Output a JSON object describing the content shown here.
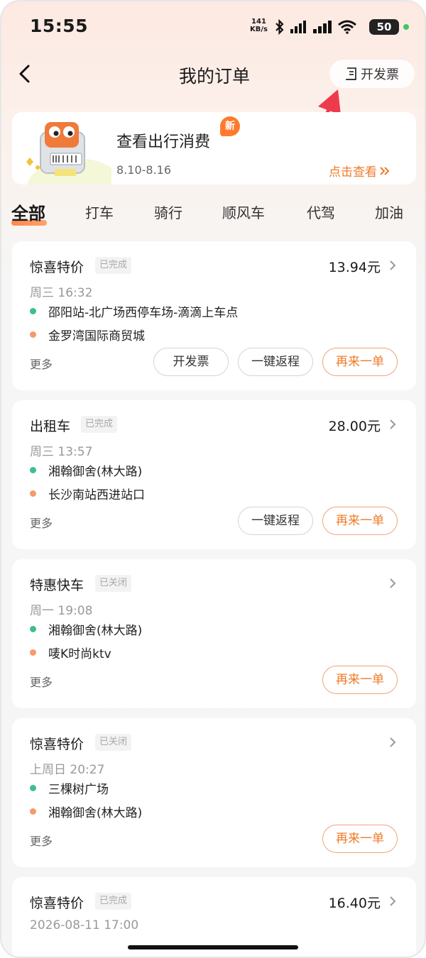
{
  "status_bar": {
    "time": "15:55",
    "network_speed": "141",
    "network_unit": "KB/s",
    "battery": "50"
  },
  "header": {
    "title": "我的订单",
    "invoice_label": "开发票"
  },
  "banner": {
    "title": "查看出行消费",
    "badge": "新",
    "date_range": "8.10-8.16",
    "link_label": "点击查看"
  },
  "tabs": [
    {
      "label": "全部",
      "active": true
    },
    {
      "label": "打车",
      "active": false
    },
    {
      "label": "骑行",
      "active": false
    },
    {
      "label": "顺风车",
      "active": false
    },
    {
      "label": "代驾",
      "active": false
    },
    {
      "label": "加油",
      "active": false
    }
  ],
  "orders": [
    {
      "title": "惊喜特价",
      "status": "已完成",
      "price": "13.94元",
      "time": "周三 16:32",
      "from": "邵阳站-北广场西停车场-滴滴上车点",
      "to": "金罗湾国际商贸城",
      "more": "更多",
      "buttons": [
        "开发票",
        "一键返程",
        "再来一单"
      ]
    },
    {
      "title": "出租车",
      "status": "已完成",
      "price": "28.00元",
      "time": "周三 13:57",
      "from": "湘翰御舍(林大路)",
      "to": "长沙南站西进站口",
      "more": "更多",
      "buttons": [
        "一键返程",
        "再来一单"
      ]
    },
    {
      "title": "特惠快车",
      "status": "已关闭",
      "price": "",
      "time": "周一 19:08",
      "from": "湘翰御舍(林大路)",
      "to": "唛K时尚ktv",
      "more": "更多",
      "buttons": [
        "再来一单"
      ]
    },
    {
      "title": "惊喜特价",
      "status": "已关闭",
      "price": "",
      "time": "上周日 20:27",
      "from": "三棵树广场",
      "to": "湘翰御舍(林大路)",
      "more": "更多",
      "buttons": [
        "再来一单"
      ]
    },
    {
      "title": "惊喜特价",
      "status": "已完成",
      "price": "16.40元",
      "time": "2026-08-11 17:00"
    }
  ],
  "colors": {
    "accent": "#f07a2a",
    "from_dot": "#3fbf8a",
    "to_dot": "#f59a6a"
  }
}
